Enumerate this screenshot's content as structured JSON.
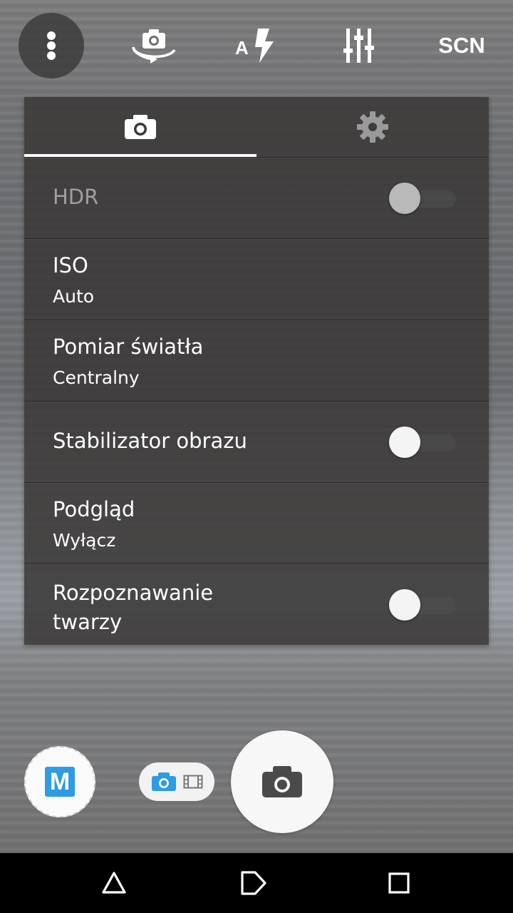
{
  "toolbar": {
    "menu_icon": "more-vert-icon",
    "switch_camera_icon": "camera-rotate-icon",
    "flash_icon": "flash-auto-icon",
    "adjust_icon": "sliders-icon",
    "scene_label": "SCN"
  },
  "tabs": [
    {
      "icon": "camera-icon",
      "active": true
    },
    {
      "icon": "gear-icon",
      "active": false
    }
  ],
  "settings": {
    "hdr": {
      "title": "HDR",
      "enabled": false,
      "on": false
    },
    "iso": {
      "title": "ISO",
      "value": "Auto"
    },
    "metering": {
      "title": "Pomiar światła",
      "value": "Centralny"
    },
    "stabilizer": {
      "title": "Stabilizator obrazu",
      "on": false
    },
    "preview": {
      "title": "Podgląd",
      "value": "Wyłącz"
    },
    "face": {
      "title": "Rozpoznawanie twarzy",
      "on": false
    }
  },
  "bottom": {
    "mode_label": "M",
    "accent_color": "#2e9be3"
  },
  "navbar": {
    "back_icon": "triangle-back-icon",
    "home_icon": "home-icon",
    "recents_icon": "square-recents-icon"
  }
}
